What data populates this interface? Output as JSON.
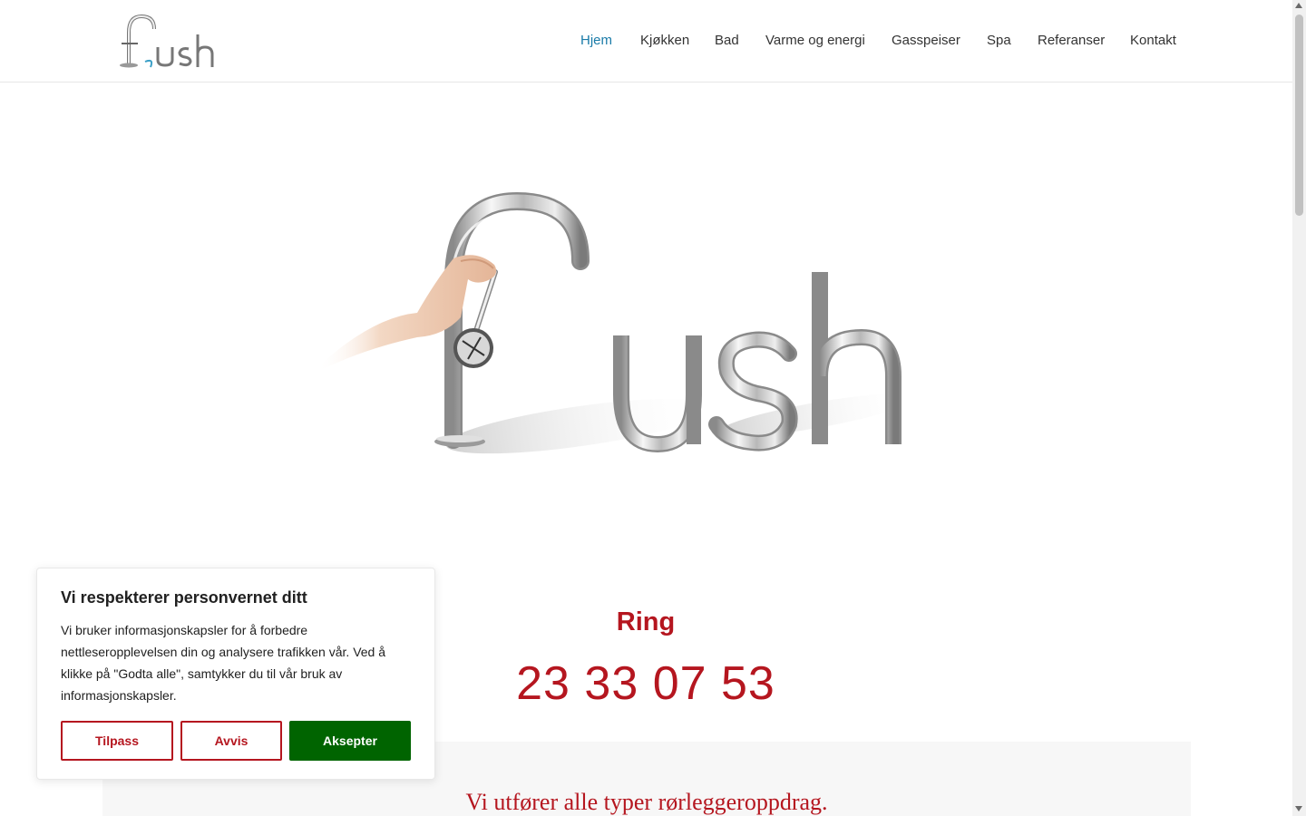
{
  "header": {
    "logo_text": "flush",
    "nav": [
      {
        "label": "Hjem",
        "active": true
      },
      {
        "label": "Kjøkken",
        "active": false
      },
      {
        "label": "Bad",
        "active": false
      },
      {
        "label": "Varme og energi",
        "active": false
      },
      {
        "label": "Gasspeiser",
        "active": false
      },
      {
        "label": "Spa",
        "active": false
      },
      {
        "label": "Referanser",
        "active": false
      },
      {
        "label": "Kontakt",
        "active": false
      }
    ]
  },
  "hero": {
    "image_text": "flush"
  },
  "call": {
    "label": "Ring",
    "phone": "23 33 07 53"
  },
  "panel": {
    "text": "Vi utfører alle typer rørleggeroppdrag."
  },
  "cookie": {
    "title": "Vi respekterer personvernet ditt",
    "body": "Vi bruker informasjonskapsler for å forbedre nettleseropplevelsen din og analysere trafikken vår. Ved å klikke på \"Godta alle\", samtykker du til vår bruk av informasjonskapsler.",
    "customize_label": "Tilpass",
    "reject_label": "Avvis",
    "accept_label": "Aksepter"
  },
  "colors": {
    "accent_red": "#b5161f",
    "nav_active": "#1a7ba8",
    "accept_green": "#006400"
  }
}
